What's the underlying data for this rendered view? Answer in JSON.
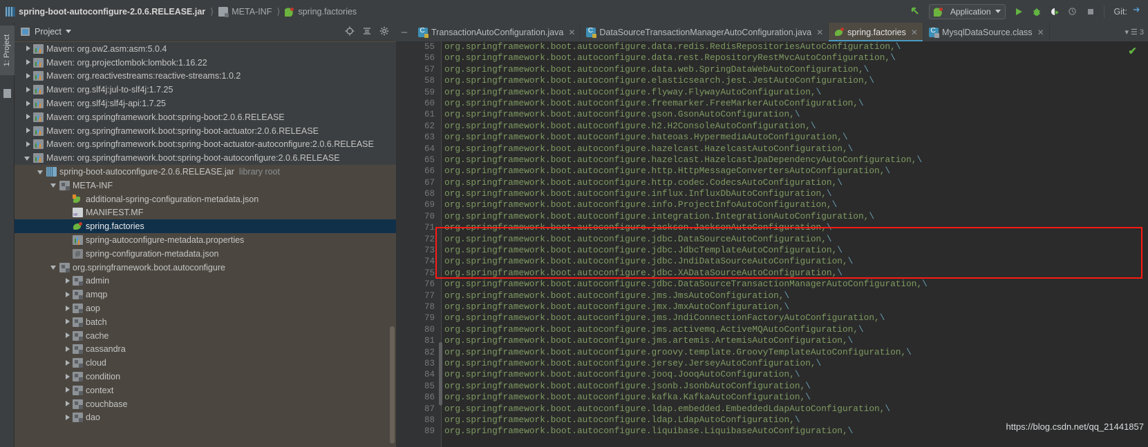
{
  "window": {
    "breadcrumb": [
      {
        "label": "spring-boot-autoconfigure-2.0.6.RELEASE.jar",
        "icon": "jar-icon"
      },
      {
        "label": "META-INF",
        "icon": "folder-icon"
      },
      {
        "label": "spring.factories",
        "icon": "spring-file-icon"
      }
    ],
    "toolbar": {
      "run_config_label": "Application",
      "git_label": "Git:",
      "icons": [
        "back-arrow-icon",
        "run-icon",
        "debug-icon",
        "run-coverage-icon",
        "profile-icon",
        "stop-icon"
      ]
    }
  },
  "left_strip": {
    "tool_tab": "1: Project"
  },
  "project_panel": {
    "title": "Project",
    "header_icons": [
      "locate-icon",
      "collapse-all-icon",
      "settings-gear-icon",
      "hide-icon"
    ],
    "tree": [
      {
        "label": "Maven: org.ow2.asm:asm:5.0.4",
        "depth": 1,
        "arrow": "closed",
        "icon": "maven-icon"
      },
      {
        "label": "Maven: org.projectlombok:lombok:1.16.22",
        "depth": 1,
        "arrow": "closed",
        "icon": "maven-icon"
      },
      {
        "label": "Maven: org.reactivestreams:reactive-streams:1.0.2",
        "depth": 1,
        "arrow": "closed",
        "icon": "maven-icon"
      },
      {
        "label": "Maven: org.slf4j:jul-to-slf4j:1.7.25",
        "depth": 1,
        "arrow": "closed",
        "icon": "maven-icon"
      },
      {
        "label": "Maven: org.slf4j:slf4j-api:1.7.25",
        "depth": 1,
        "arrow": "closed",
        "icon": "maven-icon"
      },
      {
        "label": "Maven: org.springframework.boot:spring-boot:2.0.6.RELEASE",
        "depth": 1,
        "arrow": "closed",
        "icon": "maven-icon"
      },
      {
        "label": "Maven: org.springframework.boot:spring-boot-actuator:2.0.6.RELEASE",
        "depth": 1,
        "arrow": "closed",
        "icon": "maven-icon"
      },
      {
        "label": "Maven: org.springframework.boot:spring-boot-actuator-autoconfigure:2.0.6.RELEASE",
        "depth": 1,
        "arrow": "closed",
        "icon": "maven-icon"
      },
      {
        "label": "Maven: org.springframework.boot:spring-boot-autoconfigure:2.0.6.RELEASE",
        "depth": 1,
        "arrow": "open",
        "icon": "maven-icon",
        "state": "expanded-highlight"
      },
      {
        "label": "spring-boot-autoconfigure-2.0.6.RELEASE.jar",
        "suffix": "library root",
        "depth": 2,
        "arrow": "open",
        "icon": "jar-icon"
      },
      {
        "label": "META-INF",
        "depth": 3,
        "arrow": "open",
        "icon": "folder-icon"
      },
      {
        "label": "additional-spring-configuration-metadata.json",
        "depth": 4,
        "arrow": "none",
        "icon": "spring-json-icon"
      },
      {
        "label": "MANIFEST.MF",
        "depth": 4,
        "arrow": "none",
        "icon": "manifest-icon"
      },
      {
        "label": "spring.factories",
        "depth": 4,
        "arrow": "none",
        "icon": "spring-file-icon",
        "state": "selected"
      },
      {
        "label": "spring-autoconfigure-metadata.properties",
        "depth": 4,
        "arrow": "none",
        "icon": "properties-icon"
      },
      {
        "label": "spring-configuration-metadata.json",
        "depth": 4,
        "arrow": "none",
        "icon": "config-json-icon"
      },
      {
        "label": "org.springframework.boot.autoconfigure",
        "depth": 3,
        "arrow": "open",
        "icon": "package-icon"
      },
      {
        "label": "admin",
        "depth": 4,
        "arrow": "closed",
        "icon": "package-icon"
      },
      {
        "label": "amqp",
        "depth": 4,
        "arrow": "closed",
        "icon": "package-icon"
      },
      {
        "label": "aop",
        "depth": 4,
        "arrow": "closed",
        "icon": "package-icon"
      },
      {
        "label": "batch",
        "depth": 4,
        "arrow": "closed",
        "icon": "package-icon"
      },
      {
        "label": "cache",
        "depth": 4,
        "arrow": "closed",
        "icon": "package-icon"
      },
      {
        "label": "cassandra",
        "depth": 4,
        "arrow": "closed",
        "icon": "package-icon"
      },
      {
        "label": "cloud",
        "depth": 4,
        "arrow": "closed",
        "icon": "package-icon"
      },
      {
        "label": "condition",
        "depth": 4,
        "arrow": "closed",
        "icon": "package-icon"
      },
      {
        "label": "context",
        "depth": 4,
        "arrow": "closed",
        "icon": "package-icon"
      },
      {
        "label": "couchbase",
        "depth": 4,
        "arrow": "closed",
        "icon": "package-icon"
      },
      {
        "label": "dao",
        "depth": 4,
        "arrow": "closed",
        "icon": "package-icon"
      }
    ]
  },
  "editor": {
    "tabs": [
      {
        "label": "TransactionAutoConfiguration.java",
        "icon": "java-class-icon",
        "active": false
      },
      {
        "label": "DataSourceTransactionManagerAutoConfiguration.java",
        "icon": "java-class-icon",
        "active": false
      },
      {
        "label": "spring.factories",
        "icon": "spring-file-icon",
        "active": true
      },
      {
        "label": "MysqlDataSource.class",
        "icon": "java-class-decompiled-icon",
        "active": false
      }
    ],
    "inspection_status": "✔",
    "first_line_number": 55,
    "lines": [
      {
        "n": 55,
        "text": "org.springframework.boot.autoconfigure.data.redis.RedisRepositoriesAutoConfiguration,\\"
      },
      {
        "n": 56,
        "text": "org.springframework.boot.autoconfigure.data.rest.RepositoryRestMvcAutoConfiguration,\\"
      },
      {
        "n": 57,
        "text": "org.springframework.boot.autoconfigure.data.web.SpringDataWebAutoConfiguration,\\"
      },
      {
        "n": 58,
        "text": "org.springframework.boot.autoconfigure.elasticsearch.jest.JestAutoConfiguration,\\"
      },
      {
        "n": 59,
        "text": "org.springframework.boot.autoconfigure.flyway.FlywayAutoConfiguration,\\"
      },
      {
        "n": 60,
        "text": "org.springframework.boot.autoconfigure.freemarker.FreeMarkerAutoConfiguration,\\"
      },
      {
        "n": 61,
        "text": "org.springframework.boot.autoconfigure.gson.GsonAutoConfiguration,\\"
      },
      {
        "n": 62,
        "text": "org.springframework.boot.autoconfigure.h2.H2ConsoleAutoConfiguration,\\"
      },
      {
        "n": 63,
        "text": "org.springframework.boot.autoconfigure.hateoas.HypermediaAutoConfiguration,\\"
      },
      {
        "n": 64,
        "text": "org.springframework.boot.autoconfigure.hazelcast.HazelcastAutoConfiguration,\\"
      },
      {
        "n": 65,
        "text": "org.springframework.boot.autoconfigure.hazelcast.HazelcastJpaDependencyAutoConfiguration,\\"
      },
      {
        "n": 66,
        "text": "org.springframework.boot.autoconfigure.http.HttpMessageConvertersAutoConfiguration,\\"
      },
      {
        "n": 67,
        "text": "org.springframework.boot.autoconfigure.http.codec.CodecsAutoConfiguration,\\"
      },
      {
        "n": 68,
        "text": "org.springframework.boot.autoconfigure.influx.InfluxDbAutoConfiguration,\\"
      },
      {
        "n": 69,
        "text": "org.springframework.boot.autoconfigure.info.ProjectInfoAutoConfiguration,\\"
      },
      {
        "n": 70,
        "text": "org.springframework.boot.autoconfigure.integration.IntegrationAutoConfiguration,\\"
      },
      {
        "n": 71,
        "text": "org.springframework.boot.autoconfigure.jackson.JacksonAutoConfiguration,\\"
      },
      {
        "n": 72,
        "text": "org.springframework.boot.autoconfigure.jdbc.DataSourceAutoConfiguration,\\"
      },
      {
        "n": 73,
        "text": "org.springframework.boot.autoconfigure.jdbc.JdbcTemplateAutoConfiguration,\\"
      },
      {
        "n": 74,
        "text": "org.springframework.boot.autoconfigure.jdbc.JndiDataSourceAutoConfiguration,\\"
      },
      {
        "n": 75,
        "text": "org.springframework.boot.autoconfigure.jdbc.XADataSourceAutoConfiguration,\\"
      },
      {
        "n": 76,
        "text": "org.springframework.boot.autoconfigure.jdbc.DataSourceTransactionManagerAutoConfiguration,\\"
      },
      {
        "n": 77,
        "text": "org.springframework.boot.autoconfigure.jms.JmsAutoConfiguration,\\"
      },
      {
        "n": 78,
        "text": "org.springframework.boot.autoconfigure.jmx.JmxAutoConfiguration,\\"
      },
      {
        "n": 79,
        "text": "org.springframework.boot.autoconfigure.jms.JndiConnectionFactoryAutoConfiguration,\\"
      },
      {
        "n": 80,
        "text": "org.springframework.boot.autoconfigure.jms.activemq.ActiveMQAutoConfiguration,\\"
      },
      {
        "n": 81,
        "text": "org.springframework.boot.autoconfigure.jms.artemis.ArtemisAutoConfiguration,\\"
      },
      {
        "n": 82,
        "text": "org.springframework.boot.autoconfigure.groovy.template.GroovyTemplateAutoConfiguration,\\"
      },
      {
        "n": 83,
        "text": "org.springframework.boot.autoconfigure.jersey.JerseyAutoConfiguration,\\"
      },
      {
        "n": 84,
        "text": "org.springframework.boot.autoconfigure.jooq.JooqAutoConfiguration,\\"
      },
      {
        "n": 85,
        "text": "org.springframework.boot.autoconfigure.jsonb.JsonbAutoConfiguration,\\"
      },
      {
        "n": 86,
        "text": "org.springframework.boot.autoconfigure.kafka.KafkaAutoConfiguration,\\"
      },
      {
        "n": 87,
        "text": "org.springframework.boot.autoconfigure.ldap.embedded.EmbeddedLdapAutoConfiguration,\\"
      },
      {
        "n": 88,
        "text": "org.springframework.boot.autoconfigure.ldap.LdapAutoConfiguration,\\"
      },
      {
        "n": 89,
        "text": "org.springframework.boot.autoconfigure.liquibase.LiquibaseAutoConfiguration,\\"
      }
    ],
    "highlight_box": {
      "from_line": 72,
      "to_line": 76,
      "color": "#ff1a14"
    }
  },
  "watermark": "https://blog.csdn.net/qq_21441857",
  "colors": {
    "accent": "#4a9bc4",
    "code_green": "#7f9b62",
    "selection_blue": "#10304a",
    "panel_brown": "#4b4740",
    "highlight_red": "#ff1a14",
    "run_green": "#62b543"
  }
}
